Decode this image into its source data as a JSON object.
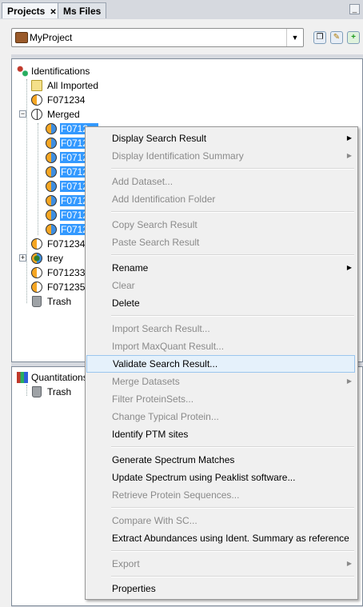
{
  "tabs": [
    {
      "label": "Projects",
      "close": "✕"
    },
    {
      "label": "Ms Files"
    }
  ],
  "window_controls": {
    "minimize": "_"
  },
  "project_selector": {
    "value": "MyProject",
    "arrow": "▼"
  },
  "toolbar": {
    "new": "❐",
    "edit": "✎",
    "add": "+"
  },
  "identifications_tree": {
    "root": "Identifications",
    "all_imported": "All Imported",
    "f071234_a": "F071234",
    "merged": "Merged",
    "merged_children": [
      "F0712…",
      "F0712",
      "F0712",
      "F0712",
      "F0712",
      "F0712",
      "F0712",
      "F0712"
    ],
    "f071234_b": "F071234",
    "trey": "trey",
    "f071233": "F071233",
    "f071235": "F071235",
    "trash": "Trash"
  },
  "quantitations_tree": {
    "root": "Quantitations",
    "trash": "Trash"
  },
  "context_menu": {
    "display_search_result": "Display Search Result",
    "display_identification_summary": "Display Identification Summary",
    "add_dataset": "Add Dataset...",
    "add_identification_folder": "Add Identification Folder",
    "copy_search_result": "Copy Search Result",
    "paste_search_result": "Paste Search Result",
    "rename": "Rename",
    "clear": "Clear",
    "delete": "Delete",
    "import_search_result": "Import Search Result...",
    "import_maxquant_result": "Import MaxQuant Result...",
    "validate_search_result": "Validate Search Result...",
    "merge_datasets": "Merge Datasets",
    "filter_proteinsets": "Filter ProteinSets...",
    "change_typical_protein": "Change Typical Protein...",
    "identify_ptm_sites": "Identify PTM sites",
    "generate_spectrum_matches": "Generate Spectrum Matches",
    "update_spectrum": "Update Spectrum using Peaklist software...",
    "retrieve_protein_sequences": "Retrieve Protein Sequences...",
    "compare_with_sc": "Compare With SC...",
    "extract_abundances": "Extract Abundances using Ident. Summary as reference",
    "export": "Export",
    "properties": "Properties",
    "submenu_arrow": "▶"
  }
}
